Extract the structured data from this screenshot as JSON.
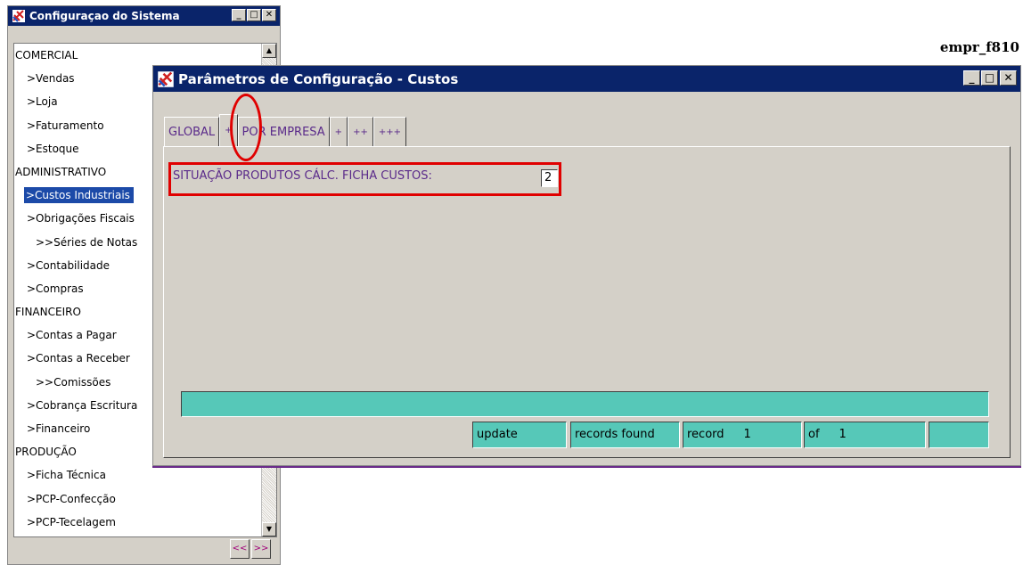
{
  "left_window": {
    "title": "Configuraçao do Sistema",
    "buttons": {
      "minimize": "_",
      "maximize": "□",
      "close": "✕"
    },
    "items": [
      {
        "label": "COMERCIAL",
        "level": 0
      },
      {
        "label": ">Vendas",
        "level": 1
      },
      {
        "label": ">Loja",
        "level": 1
      },
      {
        "label": ">Faturamento",
        "level": 1
      },
      {
        "label": ">Estoque",
        "level": 1
      },
      {
        "label": "ADMINISTRATIVO",
        "level": 0
      },
      {
        "label": ">Custos Industriais",
        "level": 1,
        "selected": true
      },
      {
        "label": ">Obrigações Fiscais",
        "level": 1
      },
      {
        "label": ">>Séries de Notas",
        "level": 2
      },
      {
        "label": ">Contabilidade",
        "level": 1
      },
      {
        "label": ">Compras",
        "level": 1
      },
      {
        "label": "FINANCEIRO",
        "level": 0
      },
      {
        "label": ">Contas a Pagar",
        "level": 1
      },
      {
        "label": ">Contas a Receber",
        "level": 1
      },
      {
        "label": ">>Comissões",
        "level": 2
      },
      {
        "label": ">Cobrança Escritura",
        "level": 1
      },
      {
        "label": ">Financeiro",
        "level": 1
      },
      {
        "label": "PRODUÇÃO",
        "level": 0
      },
      {
        "label": ">Ficha Técnica",
        "level": 1
      },
      {
        "label": ">PCP-Confecção",
        "level": 1
      },
      {
        "label": ">PCP-Tecelagem",
        "level": 1
      }
    ],
    "nav": {
      "prev": "<<",
      "next": ">>"
    }
  },
  "form_id": "empr_f810",
  "right_window": {
    "title": "Parâmetros de Configuração - Custos",
    "buttons": {
      "minimize": "_",
      "maximize": "□",
      "close": "✕"
    },
    "tabs": [
      {
        "label": "GLOBAL",
        "active": false
      },
      {
        "label": "+",
        "active": true
      },
      {
        "label": "POR EMPRESA",
        "active": false
      },
      {
        "label": "+",
        "active": false
      },
      {
        "label": "++",
        "active": false
      },
      {
        "label": "+++",
        "active": false
      }
    ],
    "field_label": "SITUAÇÃO PRODUTOS CÁLC. FICHA CUSTOS:",
    "field_value": "2",
    "status": {
      "mode": "update",
      "records_found": "records found",
      "record_label": "record",
      "record_value": "1",
      "of_label": "of",
      "of_value": "1"
    }
  },
  "colors": {
    "titlebar": "#0a246a",
    "window_bg": "#d4d0c8",
    "status_bg": "#56c8b8",
    "highlight": "#e00000",
    "label_text": "#5a2a8a",
    "selection": "#1c4aa8"
  }
}
